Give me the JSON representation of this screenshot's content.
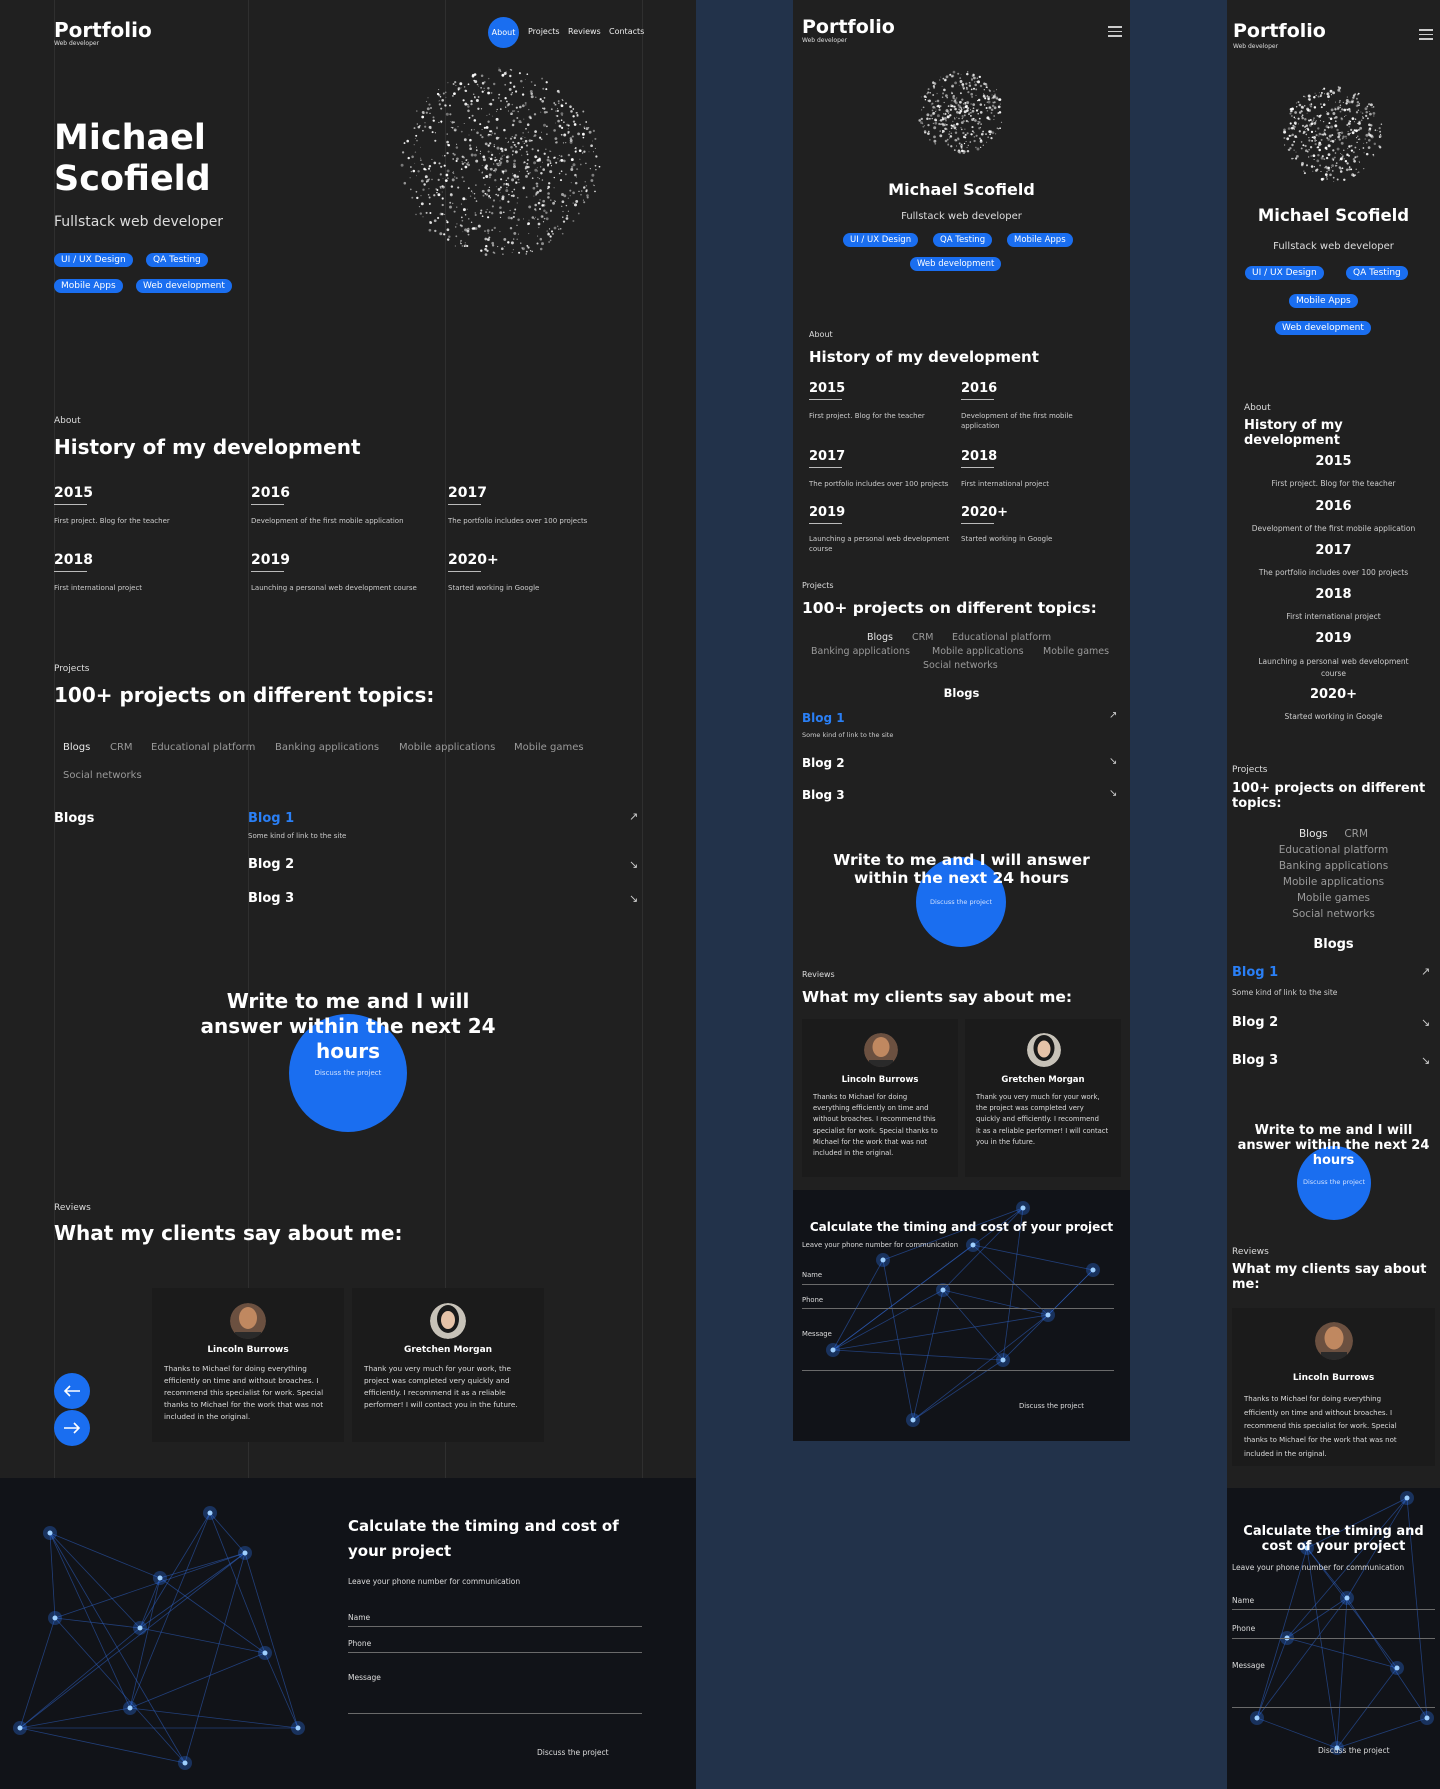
{
  "logo": {
    "title": "Portfolio",
    "subtitle": "Web developer"
  },
  "nav": {
    "about": "About",
    "projects": "Projects",
    "reviews": "Reviews",
    "contacts": "Contacts"
  },
  "hero": {
    "name_line1": "Michael",
    "name_line2": "Scofield",
    "name": "Michael Scofield",
    "role": "Fullstack web developer",
    "tags": [
      "UI / UX Design",
      "QA Testing",
      "Mobile Apps",
      "Web development"
    ]
  },
  "about": {
    "label": "About",
    "title": "History of my development",
    "mobile_title_line1": "History of my",
    "mobile_title_line2": "development",
    "timeline": [
      {
        "year": "2015",
        "text": "First project. Blog for the teacher"
      },
      {
        "year": "2016",
        "text": "Development of the first mobile application"
      },
      {
        "year": "2017",
        "text": "The portfolio includes over 100 projects"
      },
      {
        "year": "2018",
        "text": "First international project"
      },
      {
        "year": "2019",
        "text": "Launching a personal web development course"
      },
      {
        "year": "2020+",
        "text": "Started working in Google"
      }
    ]
  },
  "projects": {
    "label": "Projects",
    "title": "100+ projects on different topics:",
    "mobile_title_line1": "100+ projects on different",
    "mobile_title_line2": "topics:",
    "categories": [
      "Blogs",
      "CRM",
      "Educational platform",
      "Banking applications",
      "Mobile applications",
      "Mobile games",
      "Social networks"
    ],
    "selected": "Blogs",
    "items": [
      {
        "title": "Blog 1",
        "sub": "Some kind of link to the site"
      },
      {
        "title": "Blog 2"
      },
      {
        "title": "Blog 3"
      }
    ]
  },
  "cta": {
    "line1": "Write to me and I will",
    "line2": "answer within the next 24",
    "line3": "hours",
    "tablet_line1": "Write to me and I will answer",
    "tablet_line2": "within the next 24 hours",
    "button": "Discuss the project"
  },
  "reviews": {
    "label": "Reviews",
    "title": "What my clients say about me:",
    "mobile_title_line1": "What my clients say about",
    "mobile_title_line2": "me:",
    "items": [
      {
        "name": "Lincoln Burrows",
        "lines": [
          "Thanks to Michael for doing everything",
          "efficiently on time and without broaches. I",
          "recommend this specialist for work. Special",
          "thanks to Michael for the work that was not",
          "included in the original."
        ],
        "tablet_lines": [
          "Thanks to Michael for doing",
          "everything efficiently on time and",
          "without broaches. I recommend this",
          "specialist for work. Special thanks to",
          "Michael for the work that was not",
          "included in the original."
        ]
      },
      {
        "name": "Gretchen Morgan",
        "lines": [
          "Thank you very much for your work, the",
          "project was completed very quickly and",
          "efficiently. I recommend it as a reliable",
          "performer! I will contact you in the future."
        ],
        "tablet_lines": [
          "Thank you very much for your work,",
          "the project was completed very",
          "quickly and efficiently. I recommend",
          "it as a reliable performer! I will contact",
          "you in the future."
        ]
      }
    ]
  },
  "form": {
    "title_line1": "Calculate the timing and cost of",
    "title_line2": "your project",
    "title": "Calculate the timing and cost of your project",
    "mobile_title_line1": "Calculate the timing and",
    "mobile_title_line2": "cost of your project",
    "subtitle": "Leave your phone number for communication",
    "name_label": "Name",
    "phone_label": "Phone",
    "message_label": "Message",
    "submit": "Discuss the project"
  },
  "colors": {
    "accent": "#1a6ef0",
    "panel_bg": "#202020",
    "page_bg": "#22324a"
  }
}
